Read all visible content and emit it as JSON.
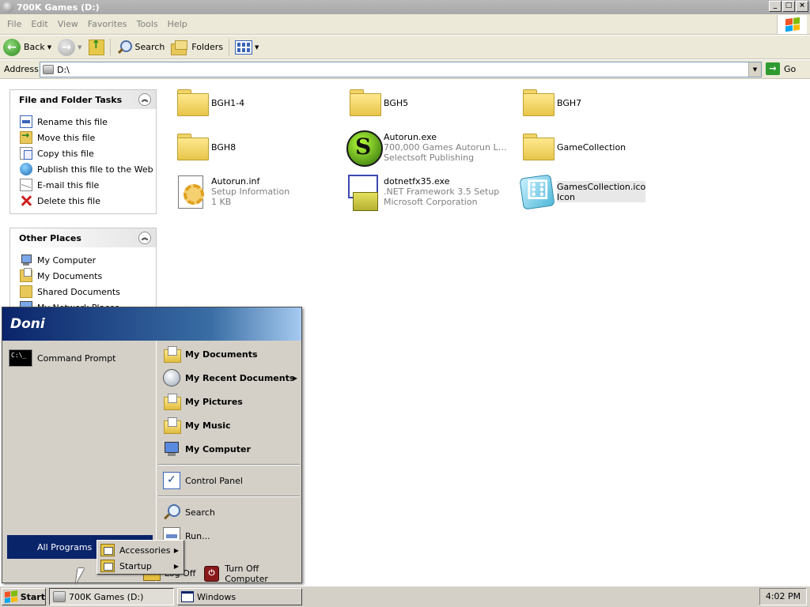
{
  "window": {
    "title": "700K Games (D:)",
    "controls": [
      "_",
      "□",
      "×"
    ]
  },
  "menubar": [
    "File",
    "Edit",
    "View",
    "Favorites",
    "Tools",
    "Help"
  ],
  "toolbar": {
    "back": "Back",
    "search": "Search",
    "folders": "Folders"
  },
  "address": {
    "label": "Address",
    "value": "D:\\",
    "go": "Go"
  },
  "tasks": {
    "header": "File and Folder Tasks",
    "items": [
      "Rename this file",
      "Move this file",
      "Copy this file",
      "Publish this file to the Web",
      "E-mail this file",
      "Delete this file"
    ]
  },
  "places": {
    "header": "Other Places",
    "items": [
      "My Computer",
      "My Documents",
      "Shared Documents",
      "My Network Places"
    ]
  },
  "files": [
    {
      "name": "BGH1-4",
      "sub1": "",
      "sub2": "",
      "icon": "folder-icon"
    },
    {
      "name": "BGH5",
      "sub1": "",
      "sub2": "",
      "icon": "folder-icon"
    },
    {
      "name": "BGH7",
      "sub1": "",
      "sub2": "",
      "icon": "folder-icon"
    },
    {
      "name": "BGH8",
      "sub1": "",
      "sub2": "",
      "icon": "folder-icon"
    },
    {
      "name": "Autorun.exe",
      "sub1": "700,000 Games Autorun Laun...",
      "sub2": "Selectsoft Publishing",
      "icon": "autorun-exe-icon"
    },
    {
      "name": "GameCollection",
      "sub1": "",
      "sub2": "",
      "icon": "folder-icon"
    },
    {
      "name": "Autorun.inf",
      "sub1": "Setup Information",
      "sub2": "1 KB",
      "icon": "setup-info-icon"
    },
    {
      "name": "dotnetfx35.exe",
      "sub1": ".NET Framework 3.5 Setup",
      "sub2": "Microsoft Corporation",
      "icon": "installer-icon"
    },
    {
      "name": "GamesCollection.ico",
      "sub1": "Icon",
      "sub2": "",
      "icon": "dice-icon"
    }
  ],
  "startmenu": {
    "user": "Doni",
    "pinned": [
      "Command Prompt"
    ],
    "right": [
      "My Documents",
      "My Recent Documents",
      "My Pictures",
      "My Music",
      "My Computer",
      "Control Panel",
      "Search",
      "Run..."
    ],
    "all_programs": "All Programs",
    "log_off": "Log Off",
    "turn_off": "Turn Off Computer"
  },
  "submenu": [
    "Accessories",
    "Startup"
  ],
  "taskbar": {
    "start": "Start",
    "tasks": [
      "700K Games (D:)",
      "Windows"
    ],
    "clock": "4:02 PM"
  }
}
